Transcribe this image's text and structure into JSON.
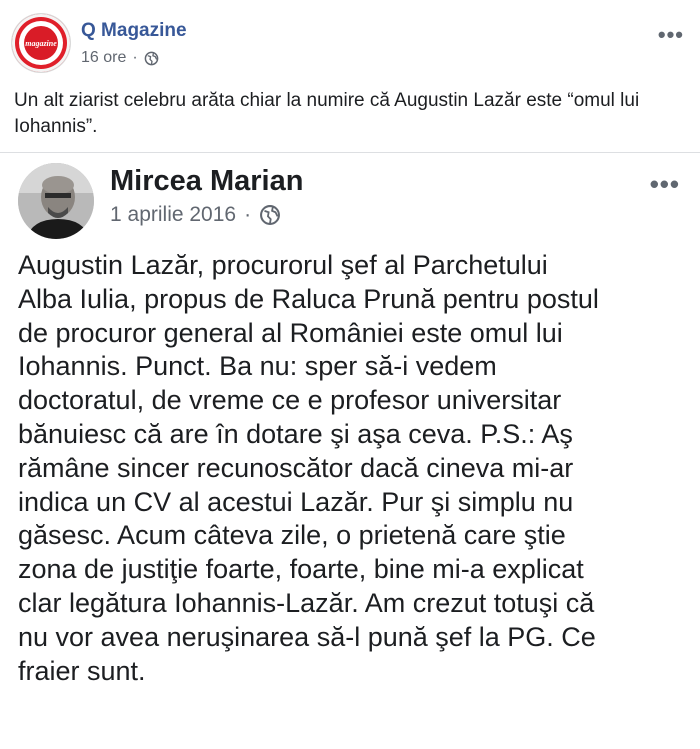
{
  "page_post": {
    "page_name": "Q Magazine",
    "time": "16 ore",
    "privacy_icon": "globe-icon",
    "more_label": "•••",
    "caption": "Un alt ziarist celebru arăta chiar la numire că Augustin Lazăr este “omul lui Iohannis”.",
    "logo_text": "magazine"
  },
  "shared_post": {
    "author_name": "Mircea Marian",
    "date": "1 aprilie 2016",
    "separator": "·",
    "privacy_icon": "globe-icon",
    "more_label": "•••",
    "body_lines": [
      "Augustin Lazăr, procurorul şef al Parchetului",
      "Alba Iulia, propus de Raluca Prună pentru postul",
      "de procuror general al României este omul lui",
      "Iohannis. Punct. Ba nu: sper să-i vedem",
      "doctoratul, de vreme ce e profesor universitar",
      "bănuiesc că are în dotare şi aşa ceva. P.S.: Aş",
      "rămâne sincer recunoscător dacă cineva mi-ar",
      "indica un CV al acestui Lazăr. Pur şi simplu nu",
      "găsesc. Acum câteva zile, o prietenă care ştie",
      "zona de justiţie foarte, foarte, bine mi-a explicat",
      "clar legătura Iohannis-Lazăr. Am crezut totuşi că",
      "nu vor avea neruşinarea să-l pună şef la PG. Ce",
      "fraier sunt."
    ]
  },
  "colors": {
    "link_blue": "#385898",
    "brand_red": "#e01f2a",
    "meta_gray": "#616770",
    "text": "#1c1e21"
  }
}
